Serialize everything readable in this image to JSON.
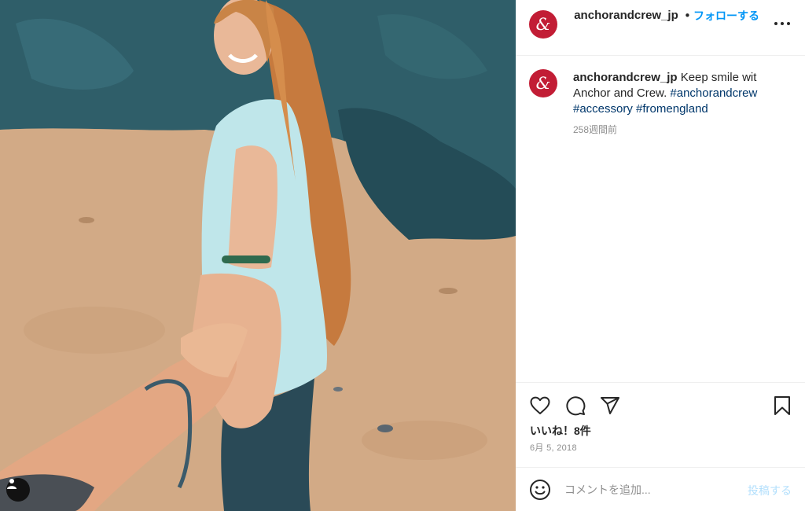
{
  "post": {
    "image_alt": "",
    "user_tag_icon": "person-icon"
  },
  "header": {
    "avatar_glyph": "&",
    "username": "anchorandcrew_jp",
    "separator": "•",
    "follow_label": "フォローする",
    "more_icon": "more-horizontal-icon"
  },
  "caption": {
    "avatar_glyph": "&",
    "username": "anchorandcrew_jp",
    "text": " Keep smile wit Anchor and Crew. ",
    "hashtags": [
      "#anchorandcrew",
      "#accessory",
      "#fromengland"
    ],
    "time": "258週間前"
  },
  "actions": {
    "icons": [
      "heart-icon",
      "comment-icon",
      "share-icon",
      "bookmark-icon"
    ],
    "likes": "いいね！8件",
    "date": "6月 5, 2018"
  },
  "comment_bar": {
    "emoji_icon": "emoji-icon",
    "placeholder": "コメントを追加...",
    "post_label": "投稿する"
  },
  "colors": {
    "brand_avatar": "#c21d35",
    "link_blue": "#0095f6",
    "hashtag": "#00376b",
    "muted": "#8e8e8e",
    "post_disabled": "#b2dffc"
  }
}
